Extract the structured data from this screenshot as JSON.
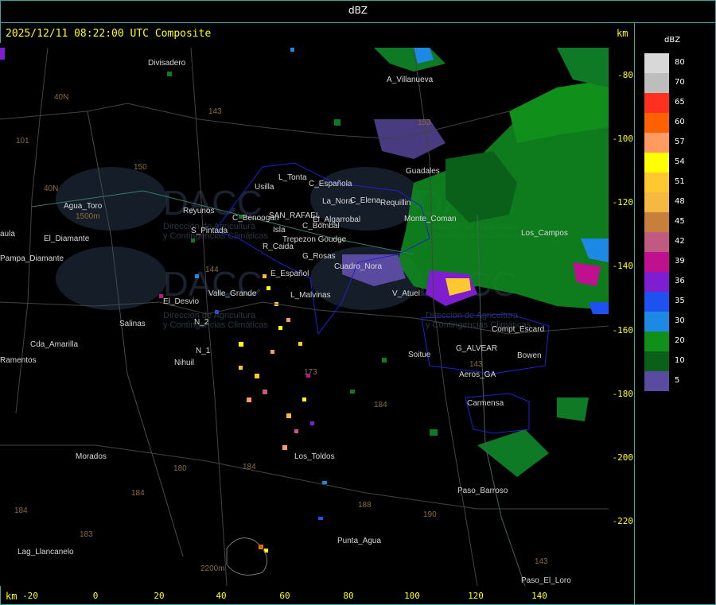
{
  "window": {
    "title": "dBZ"
  },
  "header": {
    "timestamp": "2025/12/11 08:22:00 UTC Composite",
    "unit_top": "km",
    "unit_bottom": "km"
  },
  "axes": {
    "x_ticks": [
      "-20",
      "0",
      "20",
      "40",
      "60",
      "80",
      "100",
      "120",
      "140"
    ],
    "y_ticks": [
      "-80",
      "-100",
      "-120",
      "-140",
      "-160",
      "-180",
      "-200",
      "-220"
    ]
  },
  "legend": {
    "unit": "dBZ",
    "entries": [
      {
        "label": "80",
        "color": "#d8d8d8"
      },
      {
        "label": "70",
        "color": "#bdbdbd"
      },
      {
        "label": "65",
        "color": "#ff3020"
      },
      {
        "label": "60",
        "color": "#ff6000"
      },
      {
        "label": "57",
        "color": "#ff9a60"
      },
      {
        "label": "54",
        "color": "#ffff00"
      },
      {
        "label": "51",
        "color": "#ffc830"
      },
      {
        "label": "48",
        "color": "#f5b841"
      },
      {
        "label": "45",
        "color": "#c87f3c"
      },
      {
        "label": "42",
        "color": "#c05a80"
      },
      {
        "label": "39",
        "color": "#c01090"
      },
      {
        "label": "36",
        "color": "#7e1ed0"
      },
      {
        "label": "35",
        "color": "#1f50f0"
      },
      {
        "label": "30",
        "color": "#1e88e5"
      },
      {
        "label": "20",
        "color": "#10901a"
      },
      {
        "label": "10",
        "color": "#0a6018"
      },
      {
        "label": "5",
        "color": "#5a4aa0"
      }
    ]
  },
  "map": {
    "watermark": "DACC",
    "watermark_sub_1": "Dirección de Agricultura",
    "watermark_sub_2": "y Contingencias Climáticas",
    "places": [
      {
        "name": "Divisadero"
      },
      {
        "name": "A_Villanueva"
      },
      {
        "name": "Guadales"
      },
      {
        "name": "Usilla"
      },
      {
        "name": "L_Tonta"
      },
      {
        "name": "C_Española"
      },
      {
        "name": "La_Nora"
      },
      {
        "name": "C_Elena"
      },
      {
        "name": "Requillin"
      },
      {
        "name": "Agua_Toro"
      },
      {
        "name": "Reyunos"
      },
      {
        "name": "C_Benoogan"
      },
      {
        "name": "SAN_RAFAEL"
      },
      {
        "name": "El_Algarrobal"
      },
      {
        "name": "Isla"
      },
      {
        "name": "C_Bombal"
      },
      {
        "name": "S_Pintada"
      },
      {
        "name": "Trepezon Goudge"
      },
      {
        "name": "R_Caida"
      },
      {
        "name": "G_Rosas"
      },
      {
        "name": "Cuadro_Nora"
      },
      {
        "name": "E_Español"
      },
      {
        "name": "Valle_Grande"
      },
      {
        "name": "L_Malvinas"
      },
      {
        "name": "V_Atuel"
      },
      {
        "name": "El_Desvio"
      },
      {
        "name": "Salinas"
      },
      {
        "name": "N_2"
      },
      {
        "name": "N_1"
      },
      {
        "name": "Nihuil"
      },
      {
        "name": "Cda_Amarilla"
      },
      {
        "name": "Pampa_Diamante"
      },
      {
        "name": "Soitue"
      },
      {
        "name": "G_ALVEAR"
      },
      {
        "name": "Bowen"
      },
      {
        "name": "Compt_Escard"
      },
      {
        "name": "Aeros_GA"
      },
      {
        "name": "Carmensa"
      },
      {
        "name": "Los_Toldos"
      },
      {
        "name": "Morados"
      },
      {
        "name": "Paso_Barroso"
      },
      {
        "name": "Punta_Agua"
      },
      {
        "name": "Lag_Llancanelo"
      },
      {
        "name": "Paso_El_Loro"
      },
      {
        "name": "Ramentos"
      },
      {
        "name": "aula"
      },
      {
        "name": "Los_Campos"
      },
      {
        "name": "Monte_Coman"
      },
      {
        "name": "El_Diamante"
      }
    ],
    "routes": [
      "40N",
      "40N",
      "101",
      "143",
      "150",
      "153",
      "144",
      "173",
      "184",
      "180",
      "184",
      "190",
      "183",
      "188",
      "184",
      "143",
      "184",
      "143"
    ],
    "elevations": [
      "1500m",
      "2200m"
    ]
  }
}
